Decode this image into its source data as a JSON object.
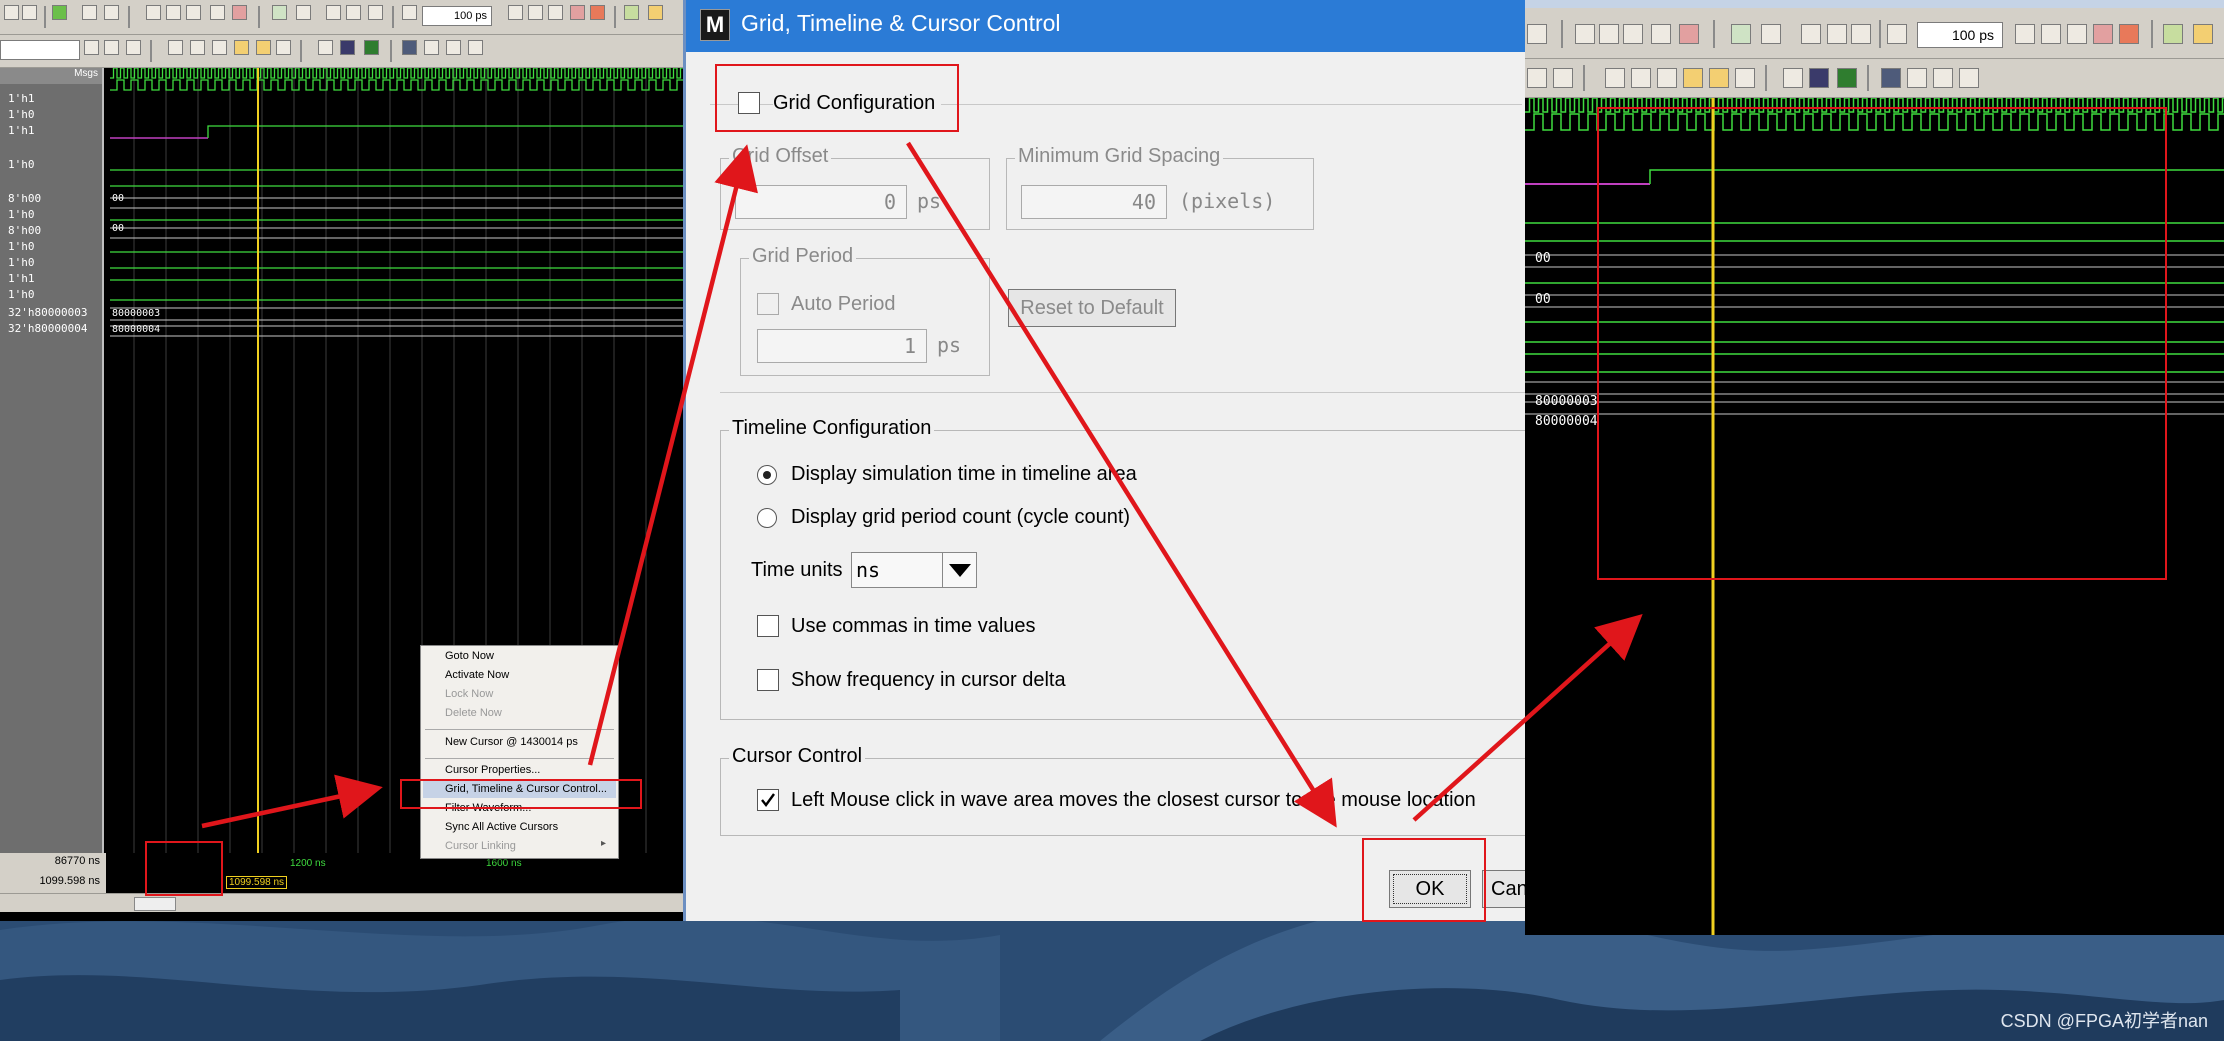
{
  "dialog": {
    "title": "Grid, Timeline & Cursor Control",
    "grid_config": {
      "label": "Grid Configuration",
      "checked": false
    },
    "grid_offset": {
      "legend": "Grid Offset",
      "value": "0",
      "unit": "ps"
    },
    "min_spacing": {
      "legend": "Minimum Grid Spacing",
      "value": "40",
      "unit": "(pixels)"
    },
    "grid_period": {
      "legend": "Grid Period",
      "auto_label": "Auto Period",
      "value": "1",
      "unit": "ps"
    },
    "reset_button": "Reset to Default",
    "timeline": {
      "legend": "Timeline Configuration",
      "radio_sim_time": "Display simulation time in timeline area",
      "radio_cycle": "Display grid period count (cycle count)",
      "time_units_label": "Time units",
      "time_units_value": "ns",
      "commas_label": "Use commas in time values",
      "freq_label": "Show frequency in cursor delta"
    },
    "cursor": {
      "legend": "Cursor Control",
      "click_label": "Left Mouse click in wave area moves the closest cursor to the mouse location",
      "checked": true
    },
    "ok_button": "OK",
    "cancel_button": "Can"
  },
  "left_panel": {
    "msgs_header": "Msgs",
    "signals": [
      "1'h1",
      "1'h0",
      "1'h1",
      "1'h0",
      "8'h00",
      "1'h0",
      "8'h00",
      "1'h0",
      "1'h0",
      "1'h1",
      "1'h0",
      "32'h80000003",
      "32'h80000004"
    ],
    "wave_values": [
      "00",
      "00",
      "80000003",
      "80000004"
    ],
    "zoom_value": "100 ps",
    "now_time": "86770 ns",
    "cursor_time": "1099.598 ns",
    "cursor_label": "1099.598 ns",
    "tick_1200": "1200 ns",
    "tick_1600": "1600 ns",
    "context_menu": [
      "Goto Now",
      "Activate Now",
      "Lock Now",
      "Delete Now",
      "New Cursor @ 1430014 ps",
      "Cursor Properties...",
      "Grid, Timeline & Cursor Control...",
      "Filter Waveform...",
      "Sync All Active Cursors",
      "Cursor Linking"
    ]
  },
  "right_panel": {
    "zoom_value": "100 ps",
    "wave_values": [
      "00",
      "00",
      "80000003",
      "80000004"
    ]
  },
  "watermark": "CSDN @FPGA初学者nan"
}
